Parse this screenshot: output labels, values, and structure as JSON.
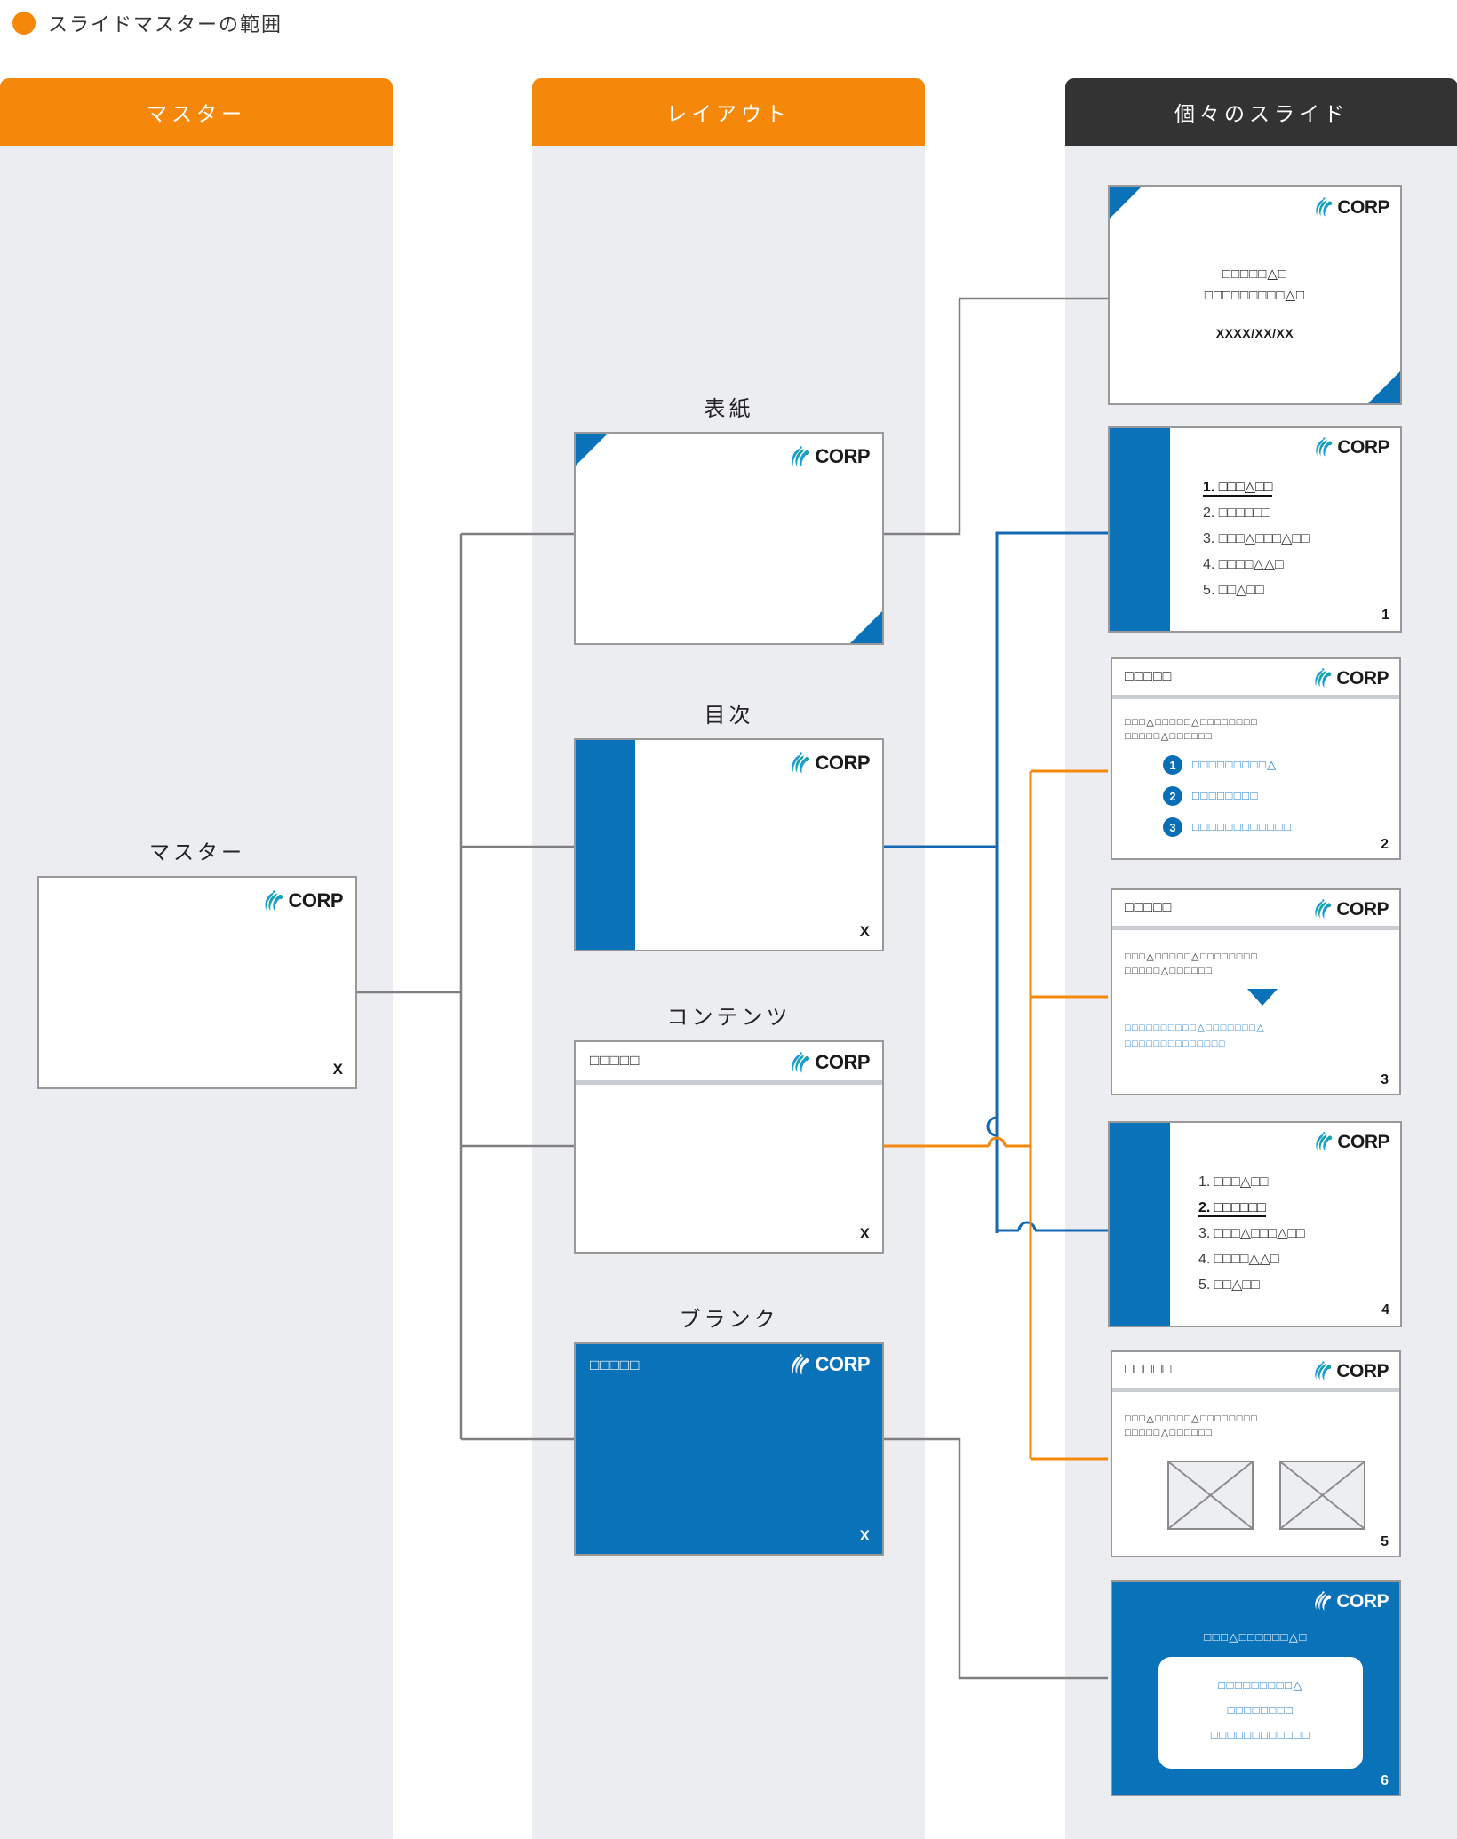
{
  "legend": {
    "label": "スライドマスターの範囲",
    "dot_color": "#F5880A"
  },
  "colors": {
    "orange": "#F5880A",
    "dark": "#333333",
    "blue": "#0A72B9",
    "panel": "#ECEDF1",
    "wire_gray": "#808080",
    "wire_blue": "#1668B3",
    "wire_orange": "#F5880A"
  },
  "brand": {
    "wordmark": "CORP",
    "mark_name": "corp-swoosh-logo"
  },
  "columns": [
    {
      "id": "master",
      "header": "マスター"
    },
    {
      "id": "layout",
      "header": "レイアウト"
    },
    {
      "id": "slides",
      "header": "個々のスライド"
    }
  ],
  "master": {
    "title": "マスター",
    "page_marker": "X"
  },
  "layouts": [
    {
      "id": "cover",
      "title": "表紙",
      "page_marker": "X",
      "header_placeholder": ""
    },
    {
      "id": "toc",
      "title": "目次",
      "page_marker": "X",
      "header_placeholder": ""
    },
    {
      "id": "contents",
      "title": "コンテンツ",
      "page_marker": "X",
      "header_placeholder": "□□□□□"
    },
    {
      "id": "blank",
      "title": "ブランク",
      "page_marker": "X",
      "header_placeholder": "□□□□□"
    }
  ],
  "slides": [
    {
      "id": "slide-cover",
      "kind": "cover",
      "page": "",
      "title_line1": "□□□□□△□",
      "title_line2": "□□□□□□□□□△□",
      "date": "XXXX/XX/XX"
    },
    {
      "id": "slide-1",
      "kind": "toc",
      "page": "1",
      "items": [
        "1. □□□△□□",
        "2. □□□□□□",
        "3. □□□△□□□△□□",
        "4. □□□□△△□",
        "5. □□△□□"
      ],
      "active_index": 0
    },
    {
      "id": "slide-2",
      "kind": "content-numbered",
      "page": "2",
      "header": "□□□□□",
      "body_line1": "□□□△□□□□□△□□□□□□□□",
      "body_line2": "□□□□□△□□□□□□",
      "numbered": [
        {
          "num": "1",
          "text": "□□□□□□□□□△"
        },
        {
          "num": "2",
          "text": "□□□□□□□□"
        },
        {
          "num": "3",
          "text": "□□□□□□□□□□□□"
        }
      ]
    },
    {
      "id": "slide-3",
      "kind": "content-arrow",
      "page": "3",
      "header": "□□□□□",
      "body_line1": "□□□△□□□□□△□□□□□□□□",
      "body_line2": "□□□□□△□□□□□□",
      "arrow_name": "down-triangle-icon",
      "result_line1": "□□□□□□□□□□△□□□□□□□△",
      "result_line2": "□□□□□□□□□□□□□□"
    },
    {
      "id": "slide-4",
      "kind": "toc",
      "page": "4",
      "items": [
        "1. □□□△□□",
        "2. □□□□□□",
        "3. □□□△□□□△□□",
        "4. □□□□△△□",
        "5. □□△□□"
      ],
      "active_index": 1
    },
    {
      "id": "slide-5",
      "kind": "content-images",
      "page": "5",
      "header": "□□□□□",
      "body_line1": "□□□△□□□□□△□□□□□□□□",
      "body_line2": "□□□□□△□□□□□□",
      "images": [
        "image-placeholder-left",
        "image-placeholder-right"
      ]
    },
    {
      "id": "slide-6",
      "kind": "blank-blue",
      "page": "6",
      "heading": "□□□△□□□□□□△□",
      "card_lines": [
        "□□□□□□□□□△",
        "□□□□□□□□",
        "□□□□□□□□□□□□"
      ]
    }
  ]
}
